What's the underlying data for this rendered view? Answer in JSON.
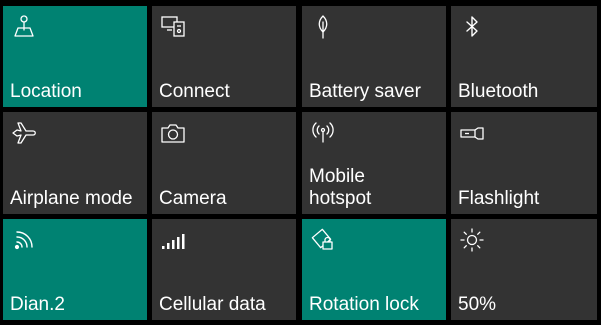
{
  "action_center": {
    "accent_color": "#008272",
    "tile_color": "#333333",
    "text_color": "#ffffff",
    "tiles": [
      {
        "label": "Location",
        "icon": "location-icon",
        "state": "on"
      },
      {
        "label": "Connect",
        "icon": "connect-icon",
        "state": "off"
      },
      {
        "label": "Battery saver",
        "icon": "battery-saver-icon",
        "state": "off"
      },
      {
        "label": "Bluetooth",
        "icon": "bluetooth-icon",
        "state": "off"
      },
      {
        "label": "Airplane mode",
        "icon": "airplane-icon",
        "state": "off"
      },
      {
        "label": "Camera",
        "icon": "camera-icon",
        "state": "off"
      },
      {
        "label": "Mobile\nhotspot",
        "icon": "hotspot-icon",
        "state": "off"
      },
      {
        "label": "Flashlight",
        "icon": "flashlight-icon",
        "state": "off"
      },
      {
        "label": "Dian.2",
        "icon": "wifi-icon",
        "state": "on"
      },
      {
        "label": "Cellular data",
        "icon": "cellular-icon",
        "state": "off"
      },
      {
        "label": "Rotation lock",
        "icon": "rotation-lock-icon",
        "state": "on"
      },
      {
        "label": "50%",
        "icon": "brightness-icon",
        "state": "off"
      }
    ]
  }
}
